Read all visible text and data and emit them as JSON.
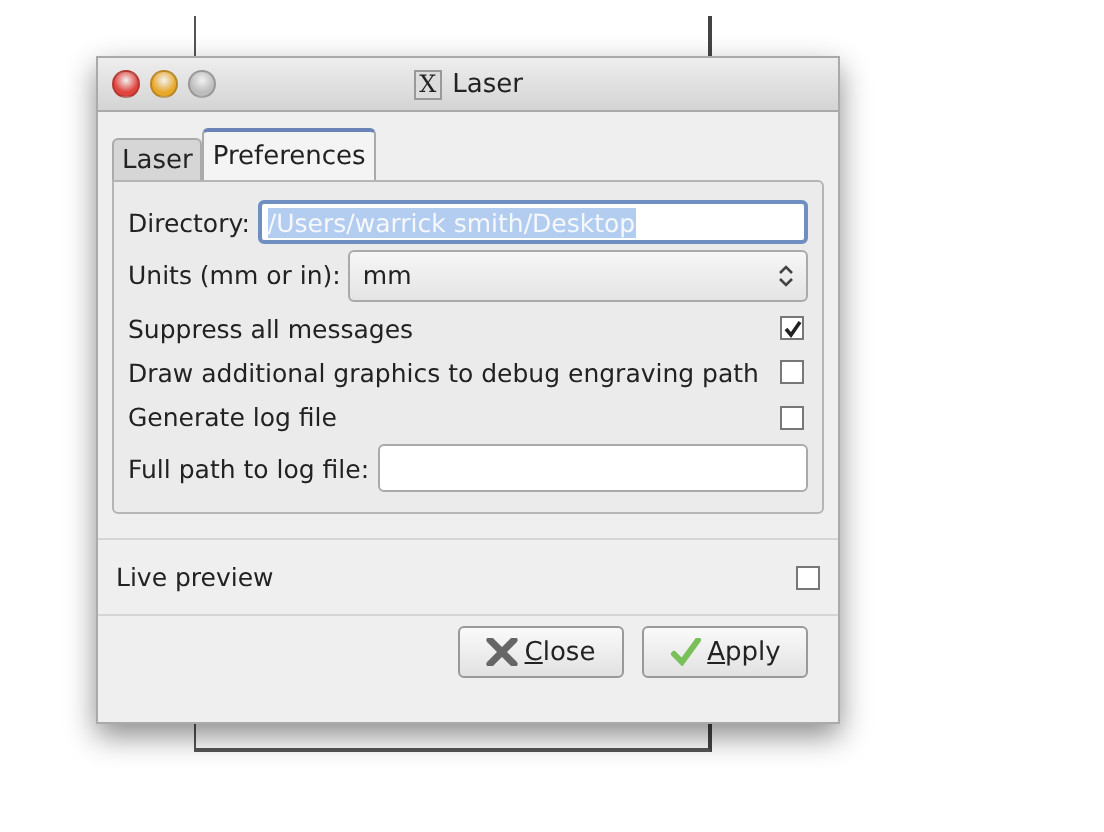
{
  "window": {
    "title": "Laser",
    "icon": "X"
  },
  "tabs": [
    {
      "label": "Laser",
      "selected": false
    },
    {
      "label": "Preferences",
      "selected": true
    }
  ],
  "directory": {
    "label": "Directory:",
    "value": "/Users/warrick smith/Desktop",
    "text_selected": true
  },
  "units": {
    "label": "Units (mm or in):",
    "value": "mm"
  },
  "options": [
    {
      "label": "Suppress all messages",
      "checked": true
    },
    {
      "label": "Draw additional graphics to debug engraving path",
      "checked": false
    },
    {
      "label": "Generate log file",
      "checked": false
    }
  ],
  "log_path": {
    "label": "Full path to log file:"
  },
  "live_preview": {
    "label": "Live preview",
    "checked": false
  },
  "buttons": [
    {
      "label": "Close",
      "kind": "close"
    },
    {
      "label": "Apply",
      "kind": "apply"
    }
  ]
}
